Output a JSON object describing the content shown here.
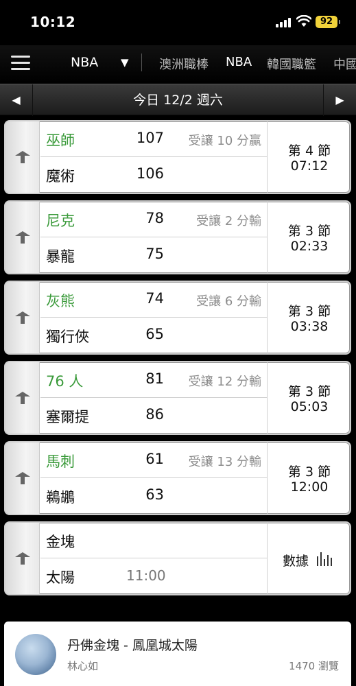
{
  "status_bar": {
    "time": "10:12",
    "battery": "92"
  },
  "nav": {
    "league": "NBA",
    "tabs": [
      "澳洲職棒",
      "NBA",
      "韓國職籃",
      "中國"
    ]
  },
  "date_bar": {
    "date": "今日 12/2 週六",
    "prev": "◀",
    "next": "▶"
  },
  "games": [
    {
      "home": "巫師",
      "home_score": "107",
      "handicap": "受讓 10 分贏",
      "away": "魔術",
      "away_score": "106",
      "period": "第 4 節",
      "clock": "07:12"
    },
    {
      "home": "尼克",
      "home_score": "78",
      "handicap": "受讓 2 分輸",
      "away": "暴龍",
      "away_score": "75",
      "period": "第 3 節",
      "clock": "02:33"
    },
    {
      "home": "灰熊",
      "home_score": "74",
      "handicap": "受讓 6 分輸",
      "away": "獨行俠",
      "away_score": "65",
      "period": "第 3 節",
      "clock": "03:38"
    },
    {
      "home": "76 人",
      "home_score": "81",
      "handicap": "受讓 12 分輸",
      "away": "塞爾提",
      "away_score": "86",
      "period": "第 3 節",
      "clock": "05:03"
    },
    {
      "home": "馬刺",
      "home_score": "61",
      "handicap": "受讓 13 分輸",
      "away": "鵜鶘",
      "away_score": "63",
      "period": "第 3 節",
      "clock": "12:00"
    }
  ],
  "upcoming": {
    "home": "金塊",
    "away": "太陽",
    "time": "11:00",
    "stats_label": "數據"
  },
  "article": {
    "title": "丹佛金塊 - 鳳凰城太陽",
    "author": "林心如",
    "views": "1470 瀏覽"
  },
  "colors": {
    "winning_team": "#3a9a3a",
    "battery": "#f1d23a"
  }
}
